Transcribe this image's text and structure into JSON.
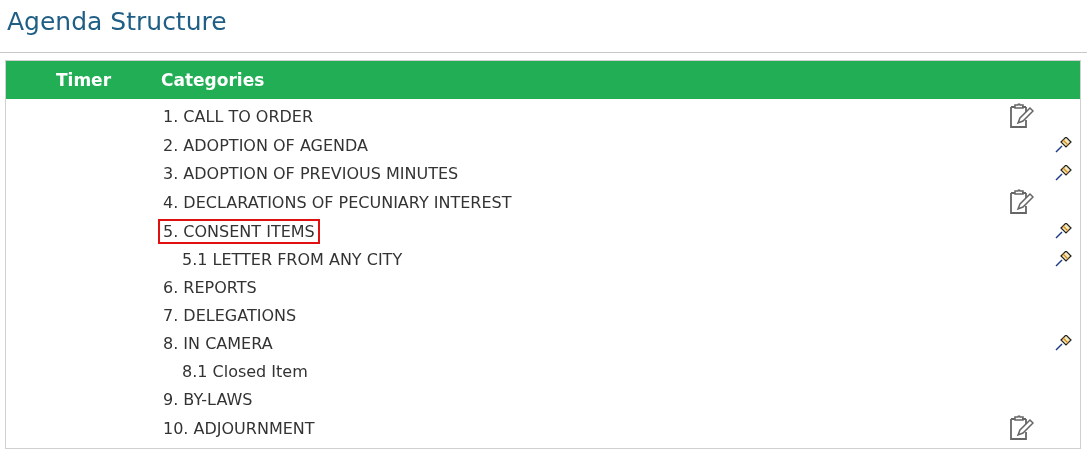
{
  "page": {
    "title": "Agenda Structure"
  },
  "table": {
    "columns": [
      "Timer",
      "Categories"
    ],
    "rows": [
      {
        "label": "1. CALL TO ORDER",
        "kind": "clipboard",
        "selected": false
      },
      {
        "label": "2. ADOPTION OF AGENDA",
        "kind": "gavel",
        "selected": false
      },
      {
        "label": "3. ADOPTION OF PREVIOUS MINUTES",
        "kind": "gavel",
        "selected": false
      },
      {
        "label": "4. DECLARATIONS OF PECUNIARY INTEREST",
        "kind": "clipboard",
        "selected": false
      },
      {
        "label": "5. CONSENT ITEMS",
        "kind": "gavel",
        "selected": true,
        "children": [
          {
            "label": "5.1 LETTER FROM ANY CITY",
            "kind": "gavel",
            "selected": false
          }
        ]
      },
      {
        "label": "6. REPORTS",
        "kind": "none",
        "selected": false
      },
      {
        "label": "7. DELEGATIONS",
        "kind": "none",
        "selected": false
      },
      {
        "label": "8. IN CAMERA",
        "kind": "gavel",
        "selected": false,
        "children": [
          {
            "label": "8.1 Closed Item",
            "kind": "none",
            "selected": false
          }
        ]
      },
      {
        "label": "9. BY-LAWS",
        "kind": "none",
        "selected": false
      },
      {
        "label": "10. ADJOURNMENT",
        "kind": "clipboard",
        "selected": false
      }
    ]
  }
}
